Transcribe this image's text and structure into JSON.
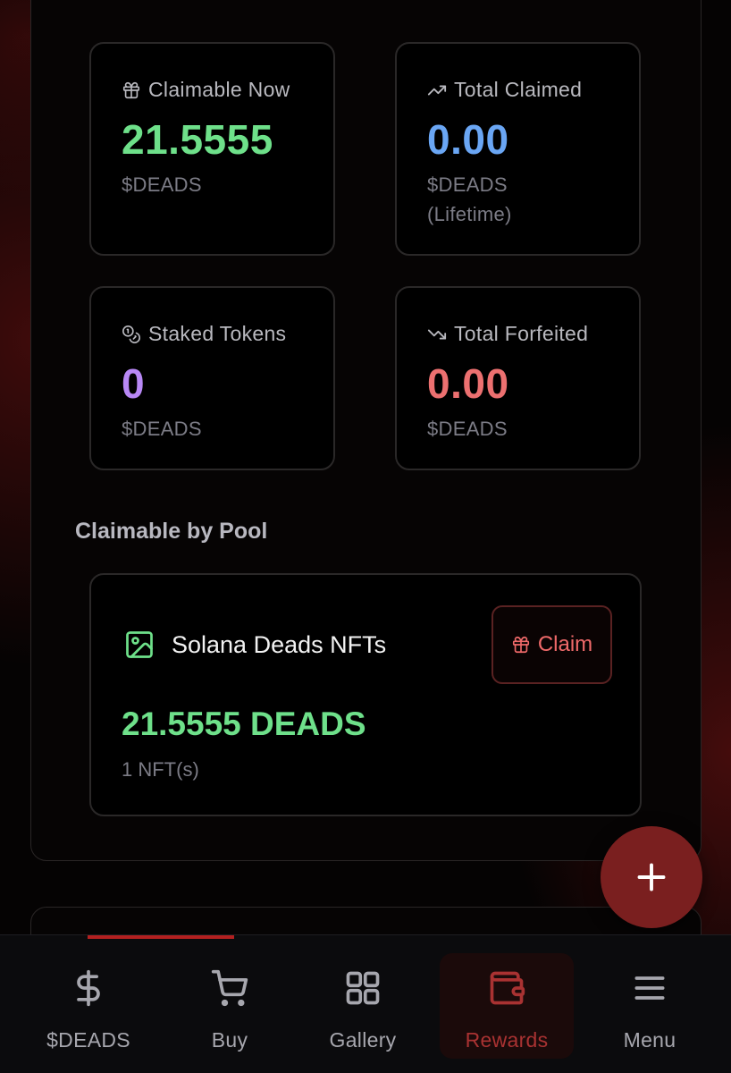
{
  "stats": [
    {
      "label": "Claimable Now",
      "value": "21.5555",
      "unit": "$DEADS",
      "color": "#6ee08a",
      "icon": "gift-icon"
    },
    {
      "label": "Total Claimed",
      "value": "0.00",
      "unit": "$DEADS",
      "unit2": "(Lifetime)",
      "color": "#6aa6f4",
      "icon": "trending-up-icon"
    },
    {
      "label": "Staked Tokens",
      "value": "0",
      "unit": "$DEADS",
      "color": "#b888f5",
      "icon": "coins-icon"
    },
    {
      "label": "Total Forfeited",
      "value": "0.00",
      "unit": "$DEADS",
      "color": "#ec7070",
      "icon": "trending-down-icon"
    }
  ],
  "pools": {
    "title": "Claimable by Pool",
    "items": [
      {
        "name": "Solana Deads NFTs",
        "icon": "image-icon",
        "claim_label": "Claim",
        "amount": "21.5555 DEADS",
        "nfts": "1 NFT(s)"
      }
    ]
  },
  "fab": {
    "icon": "plus-icon"
  },
  "tabbar": {
    "items": [
      {
        "label": "$DEADS",
        "icon": "dollar-icon"
      },
      {
        "label": "Buy",
        "icon": "cart-icon"
      },
      {
        "label": "Gallery",
        "icon": "grid-icon"
      },
      {
        "label": "Rewards",
        "icon": "wallet-icon",
        "active": true
      },
      {
        "label": "Menu",
        "icon": "menu-icon"
      }
    ],
    "accent": "#a93232"
  }
}
